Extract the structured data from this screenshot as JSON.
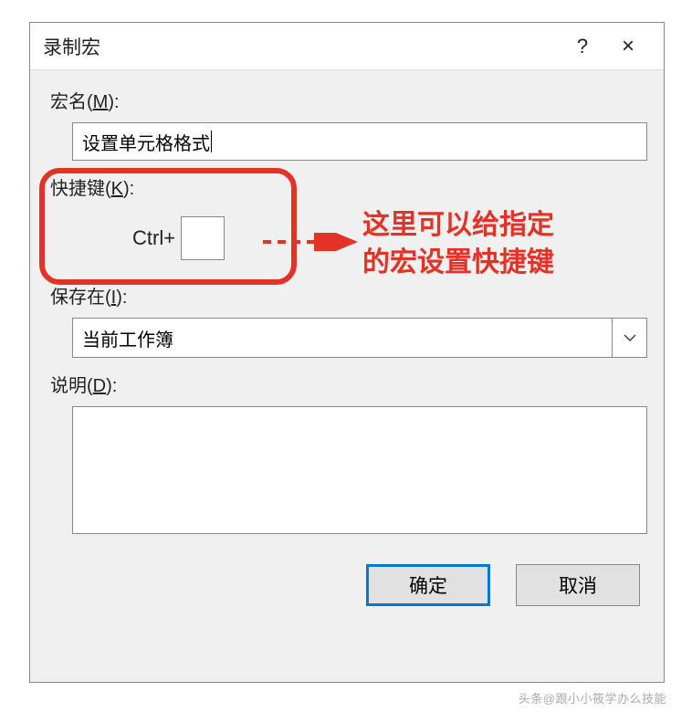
{
  "dialog": {
    "title": "录制宏",
    "help_symbol": "?",
    "close_symbol": "×"
  },
  "fields": {
    "macro_name": {
      "label_prefix": "宏名(",
      "label_key": "M",
      "label_suffix": "):",
      "value": "设置单元格格式"
    },
    "shortcut": {
      "label_prefix": "快捷键(",
      "label_key": "K",
      "label_suffix": "):",
      "ctrl_text": "Ctrl+",
      "value": ""
    },
    "save_in": {
      "label_prefix": "保存在(",
      "label_key": "I",
      "label_suffix": "):",
      "value": "当前工作簿"
    },
    "description": {
      "label_prefix": "说明(",
      "label_key": "D",
      "label_suffix": "):",
      "value": ""
    }
  },
  "buttons": {
    "ok": "确定",
    "cancel": "取消"
  },
  "annotation": {
    "line1": "这里可以给指定",
    "line2": "的宏设置快捷键"
  },
  "watermark": "头条@跟小小筱学办么技能"
}
